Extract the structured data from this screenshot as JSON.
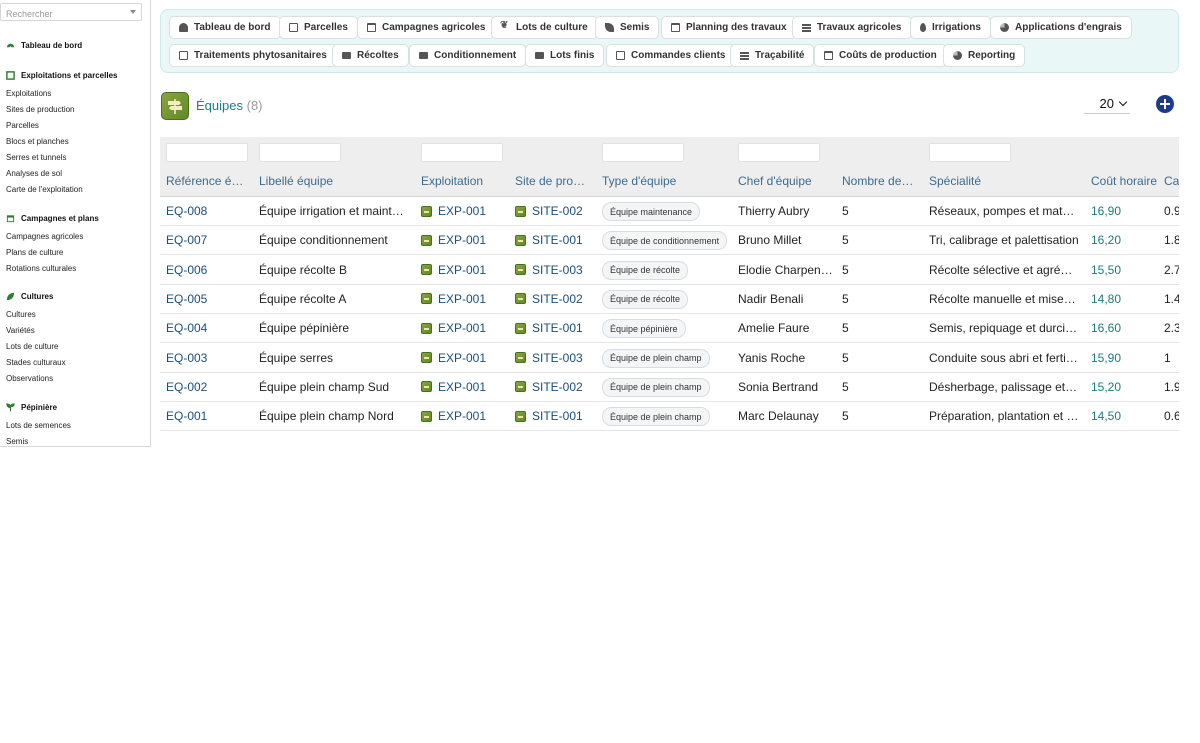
{
  "sidebar": {
    "search_placeholder": "Rechercher",
    "sections": [
      {
        "label": "Tableau de bord",
        "icon": "gauge-icon",
        "items": []
      },
      {
        "label": "Exploitations et parcelles",
        "icon": "parcel-icon",
        "items": [
          "Exploitations",
          "Sites de production",
          "Parcelles",
          "Blocs et planches",
          "Serres et tunnels",
          "Analyses de sol",
          "Carte de l'exploitation"
        ]
      },
      {
        "label": "Campagnes et plans",
        "icon": "calendar-icon",
        "items": [
          "Campagnes agricoles",
          "Plans de culture",
          "Rotations culturales"
        ]
      },
      {
        "label": "Cultures",
        "icon": "leaf-icon",
        "items": [
          "Cultures",
          "Variétés",
          "Lots de culture",
          "Stades culturaux",
          "Observations"
        ]
      },
      {
        "label": "Pépinière",
        "icon": "sprout-icon",
        "items": [
          "Lots de semences",
          "Semis"
        ]
      }
    ]
  },
  "nav": {
    "row1": [
      {
        "label": "Tableau de bord",
        "icon": "gauge-icon"
      },
      {
        "label": "Parcelles",
        "icon": "parcel-icon"
      },
      {
        "label": "Campagnes agricoles",
        "icon": "calendar-icon"
      },
      {
        "label": "Lots de culture",
        "icon": "sprout-icon"
      },
      {
        "label": "Semis",
        "icon": "leaf-icon"
      },
      {
        "label": "Planning des travaux",
        "icon": "planning-icon"
      },
      {
        "label": "Travaux agricoles",
        "icon": "list-icon"
      },
      {
        "label": "Irrigations",
        "icon": "drop-icon"
      },
      {
        "label": "Applications d'engrais",
        "icon": "fertilizer-icon"
      }
    ],
    "row2": [
      {
        "label": "Traitements phytosanitaires",
        "icon": "spray-icon"
      },
      {
        "label": "Récoltes",
        "icon": "basket-icon"
      },
      {
        "label": "Conditionnement",
        "icon": "truck-icon"
      },
      {
        "label": "Lots finis",
        "icon": "pallet-icon"
      },
      {
        "label": "Commandes clients",
        "icon": "document-icon"
      },
      {
        "label": "Traçabilité",
        "icon": "barcode-icon"
      },
      {
        "label": "Coûts de production",
        "icon": "cost-icon"
      },
      {
        "label": "Reporting",
        "icon": "pie-icon"
      }
    ]
  },
  "page": {
    "title": "Équipes",
    "count": "(8)",
    "page_size": "20"
  },
  "table": {
    "columns": [
      "Référence équipe",
      "Libellé équipe",
      "Exploitation",
      "Site de production",
      "Type d'équipe",
      "Chef d'équipe",
      "Nombre de membres",
      "Spécialité",
      "Coût horaire",
      "Ca"
    ],
    "rows": [
      {
        "ref": "EQ-008",
        "label": "Équipe irrigation et maintenance",
        "exp": "EXP-001",
        "site": "SITE-002",
        "type": "Équipe maintenance",
        "chef": "Thierry Aubry",
        "nb": "5",
        "spec": "Réseaux, pompes et matériel",
        "cost": "16,90",
        "extra": "0.9"
      },
      {
        "ref": "EQ-007",
        "label": "Équipe conditionnement",
        "exp": "EXP-001",
        "site": "SITE-001",
        "type": "Équipe de conditionnement",
        "chef": "Bruno Millet",
        "nb": "5",
        "spec": "Tri, calibrage et palettisation",
        "cost": "16,20",
        "extra": "1.8"
      },
      {
        "ref": "EQ-006",
        "label": "Équipe récolte B",
        "exp": "EXP-001",
        "site": "SITE-003",
        "type": "Équipe de récolte",
        "chef": "Elodie Charpentier",
        "nb": "5",
        "spec": "Récolte sélective et agréage",
        "cost": "15,50",
        "extra": "2.7"
      },
      {
        "ref": "EQ-005",
        "label": "Équipe récolte A",
        "exp": "EXP-001",
        "site": "SITE-002",
        "type": "Équipe de récolte",
        "chef": "Nadir Benali",
        "nb": "5",
        "spec": "Récolte manuelle et mise en",
        "cost": "14,80",
        "extra": "1.4"
      },
      {
        "ref": "EQ-004",
        "label": "Équipe pépinière",
        "exp": "EXP-001",
        "site": "SITE-001",
        "type": "Équipe pépinière",
        "chef": "Amelie Faure",
        "nb": "5",
        "spec": "Semis, repiquage et durcissement",
        "cost": "16,60",
        "extra": "2.3"
      },
      {
        "ref": "EQ-003",
        "label": "Équipe serres",
        "exp": "EXP-001",
        "site": "SITE-003",
        "type": "Équipe de plein champ",
        "chef": "Yanis Roche",
        "nb": "5",
        "spec": "Conduite sous abri et fertigation",
        "cost": "15,90",
        "extra": "1"
      },
      {
        "ref": "EQ-002",
        "label": "Équipe plein champ Sud",
        "exp": "EXP-001",
        "site": "SITE-002",
        "type": "Équipe de plein champ",
        "chef": "Sonia Bertrand",
        "nb": "5",
        "spec": "Désherbage, palissage et taille",
        "cost": "15,20",
        "extra": "1.9"
      },
      {
        "ref": "EQ-001",
        "label": "Équipe plein champ Nord",
        "exp": "EXP-001",
        "site": "SITE-001",
        "type": "Équipe de plein champ",
        "chef": "Marc Delaunay",
        "nb": "5",
        "spec": "Préparation, plantation et entretien",
        "cost": "14,50",
        "extra": "0.6"
      }
    ]
  },
  "colors": {
    "accent": "#1c7c8a",
    "link": "#1a4f7a",
    "nav_bg": "#eaf7f7",
    "add_button": "#1e3a8a",
    "icon_green": "#6f9632"
  }
}
